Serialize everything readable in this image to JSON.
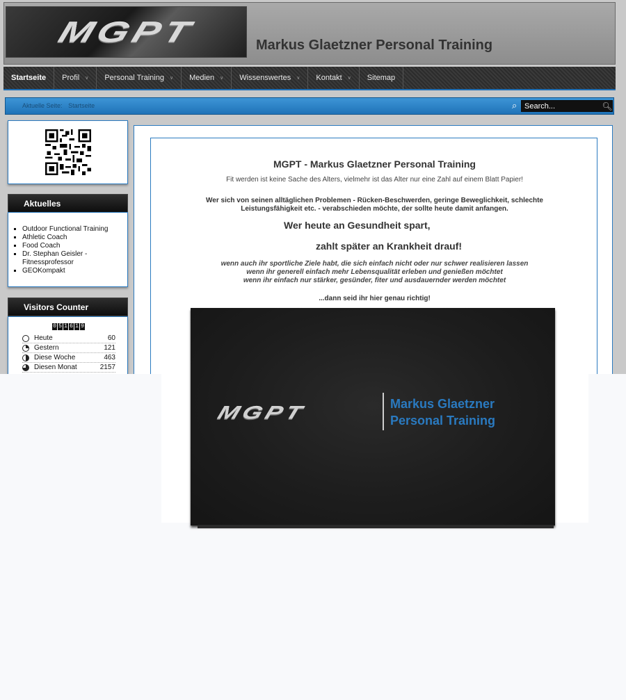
{
  "header": {
    "logo_text": "MGPT",
    "site_title": "Markus Glaetzner Personal Training"
  },
  "nav": {
    "items": [
      {
        "label": "Startseite",
        "active": true,
        "has_submenu": false
      },
      {
        "label": "Profil",
        "active": false,
        "has_submenu": true
      },
      {
        "label": "Personal Training",
        "active": false,
        "has_submenu": true
      },
      {
        "label": "Medien",
        "active": false,
        "has_submenu": true
      },
      {
        "label": "Wissenswertes",
        "active": false,
        "has_submenu": true
      },
      {
        "label": "Kontakt",
        "active": false,
        "has_submenu": true
      },
      {
        "label": "Sitemap",
        "active": false,
        "has_submenu": false
      }
    ],
    "caret": "∨"
  },
  "breadcrumb": {
    "label": "Aktuelle Seite:",
    "current": "Startseite"
  },
  "search": {
    "value": "Search..."
  },
  "sidebar": {
    "news_title": "Aktuelles",
    "news_items": [
      "Outdoor Functional Training",
      "Athletic Coach",
      "Food Coach",
      "Dr. Stephan Geisler - Fitnessprofessor",
      "GEOKompakt"
    ],
    "counter_title": "Visitors Counter",
    "counter_digits": [
      "0",
      "5",
      "1",
      "6",
      "1",
      "9"
    ],
    "stats": [
      {
        "label": "Heute",
        "value": "60"
      },
      {
        "label": "Gestern",
        "value": "121"
      },
      {
        "label": "Diese Woche",
        "value": "463"
      },
      {
        "label": "Diesen Monat",
        "value": "2157"
      }
    ]
  },
  "article": {
    "title": "MGPT - Markus Glaetzner Personal Training",
    "subtitle": "Fit werden ist keine Sache des Alters, vielmehr ist das Alter nur eine Zahl auf einem Blatt Papier!",
    "bold_text": "Wer sich von seinen alltäglichen Problemen - Rücken-Beschwerden, geringe Beweglichkeit, schlechte Leistungsfähigkeit etc. - verabschieden möchte, der sollte heute damit anfangen.",
    "big_line_1": "Wer heute an Gesundheit spart,",
    "big_line_2": "zahlt später an Krankheit drauf!",
    "italic_lines": [
      "wenn auch ihr sportliche Ziele habt, die sich einfach nicht oder nur schwer realisieren lassen",
      "wenn ihr generell einfach mehr Lebensqualität erleben und genießen möchtet",
      "wenn ihr einfach nur stärker, gesünder, fiter und ausdauernder werden möchtet"
    ],
    "closing": "...dann seid ihr hier genau richtig!"
  },
  "slide": {
    "logo_text": "MGPT",
    "name_line_1": "Markus Glaetzner",
    "name_line_2": "Personal Training"
  },
  "colors": {
    "accent_blue": "#2a7ac0",
    "nav_dark": "#2c2c2c"
  }
}
